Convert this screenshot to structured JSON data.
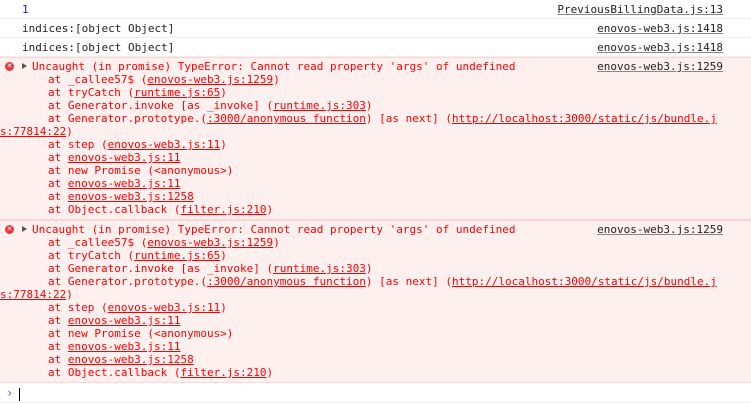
{
  "logs": [
    {
      "text": "1",
      "source": "PreviousBillingData.js:13",
      "numeric": true
    },
    {
      "text": "indices:[object Object]",
      "source": "enovos-web3.js:1418"
    },
    {
      "text": "indices:[object Object]",
      "source": "enovos-web3.js:1418"
    }
  ],
  "errors": [
    {
      "message": "Uncaught (in promise) TypeError: Cannot read property 'args' of undefined",
      "source": "enovos-web3.js:1259",
      "frames": {
        "f1_pre": "at _callee57$ (",
        "f1_link": "enovos-web3.js:1259",
        "f1_post": ")",
        "f2_pre": "at tryCatch (",
        "f2_link": "runtime.js:65",
        "f2_post": ")",
        "f3_pre": "at Generator.invoke [as _invoke] (",
        "f3_link": "runtime.js:303",
        "f3_post": ")",
        "f4_pre": "at Generator.prototype.(",
        "f4_link": ":3000/anonymous function",
        "f4_mid": ") [as next] (",
        "f4_link2": "http://localhost:3000/static/js/bundle.j",
        "f4_cont": "s:77814:22",
        "f4_post": ")",
        "f5_pre": "at step (",
        "f5_link": "enovos-web3.js:11",
        "f5_post": ")",
        "f6_pre": "at ",
        "f6_link": "enovos-web3.js:11",
        "f7": "at new Promise (<anonymous>)",
        "f8_pre": "at ",
        "f8_link": "enovos-web3.js:11",
        "f9_pre": "at ",
        "f9_link": "enovos-web3.js:1258",
        "f10_pre": "at Object.callback (",
        "f10_link": "filter.js:210",
        "f10_post": ")"
      }
    },
    {
      "message": "Uncaught (in promise) TypeError: Cannot read property 'args' of undefined",
      "source": "enovos-web3.js:1259",
      "frames": {
        "f1_pre": "at _callee57$ (",
        "f1_link": "enovos-web3.js:1259",
        "f1_post": ")",
        "f2_pre": "at tryCatch (",
        "f2_link": "runtime.js:65",
        "f2_post": ")",
        "f3_pre": "at Generator.invoke [as _invoke] (",
        "f3_link": "runtime.js:303",
        "f3_post": ")",
        "f4_pre": "at Generator.prototype.(",
        "f4_link": ":3000/anonymous function",
        "f4_mid": ") [as next] (",
        "f4_link2": "http://localhost:3000/static/js/bundle.j",
        "f4_cont": "s:77814:22",
        "f4_post": ")",
        "f5_pre": "at step (",
        "f5_link": "enovos-web3.js:11",
        "f5_post": ")",
        "f6_pre": "at ",
        "f6_link": "enovos-web3.js:11",
        "f7": "at new Promise (<anonymous>)",
        "f8_pre": "at ",
        "f8_link": "enovos-web3.js:11",
        "f9_pre": "at ",
        "f9_link": "enovos-web3.js:1258",
        "f10_pre": "at Object.callback (",
        "f10_link": "filter.js:210",
        "f10_post": ")"
      }
    }
  ],
  "prompt": {
    "caret": "›"
  },
  "colors": {
    "error_text": "#ff0000",
    "error_bg": "#fff0f0",
    "number": "#1a1aa6",
    "prompt": "#1a73e8"
  }
}
